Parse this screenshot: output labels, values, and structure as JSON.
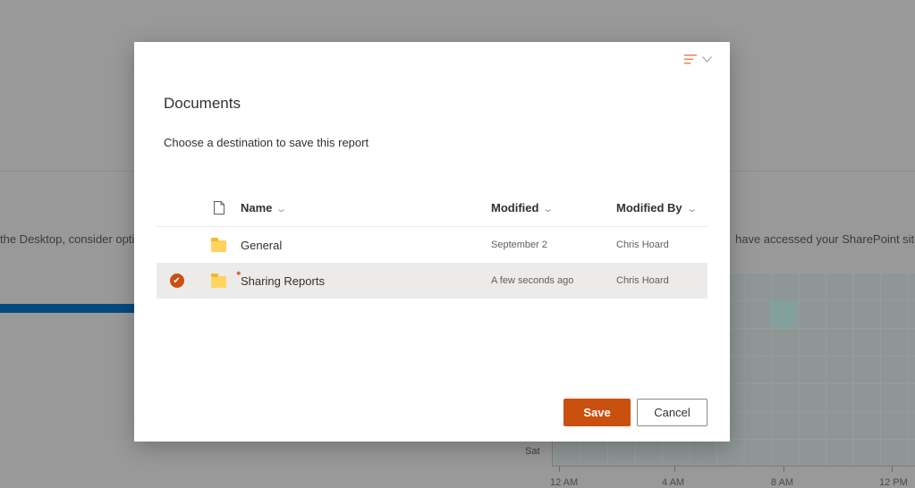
{
  "background": {
    "left_text": "the Desktop, consider opti",
    "right_text": "have accessed your SharePoint site",
    "heatmap_row_label": "Sat",
    "heatmap_x_ticks": [
      "12 AM",
      "4 AM",
      "8 AM",
      "12 PM"
    ]
  },
  "dialog": {
    "title": "Documents",
    "subtitle": "Choose a destination to save this report",
    "view_switcher_icon": "view-list-icon",
    "columns": {
      "type": "file-type-icon",
      "name": "Name",
      "modified": "Modified",
      "modified_by": "Modified By"
    },
    "rows": [
      {
        "name": "General",
        "modified": "September 2",
        "modified_by": "Chris Hoard",
        "selected": false,
        "is_new": false
      },
      {
        "name": "Sharing Reports",
        "modified": "A few seconds ago",
        "modified_by": "Chris Hoard",
        "selected": true,
        "is_new": true
      }
    ],
    "save_label": "Save",
    "cancel_label": "Cancel"
  },
  "colors": {
    "accent": "#ca5010",
    "overlay": "#999999"
  }
}
